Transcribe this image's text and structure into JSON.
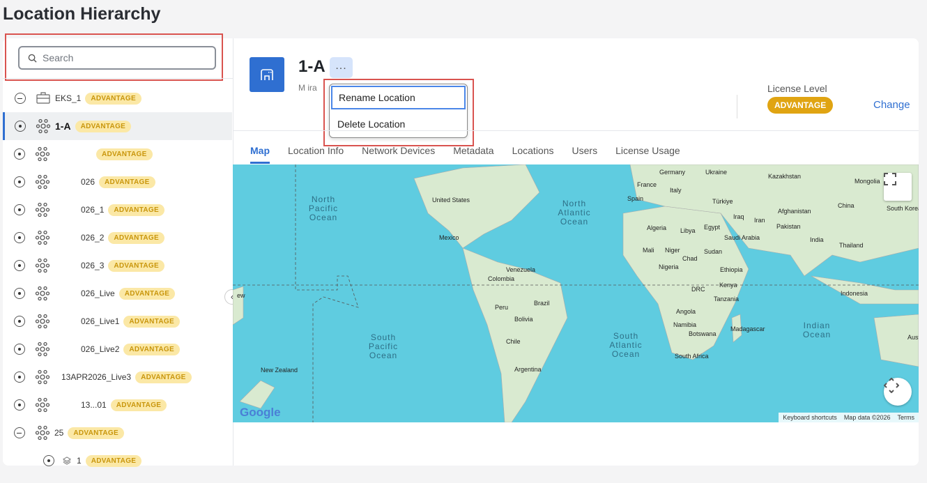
{
  "page_title": "Location Hierarchy",
  "search": {
    "placeholder": "Search"
  },
  "tree": [
    {
      "name": "EKS_1",
      "badge": "ADVANTAGE",
      "icon": "briefcase-icon",
      "toggle": "minus"
    },
    {
      "name": "1-A",
      "badge": "ADVANTAGE",
      "icon": "network-icon",
      "toggle": "dot",
      "selected": true
    },
    {
      "name": "",
      "badge": "ADVANTAGE",
      "icon": "network-icon",
      "toggle": "dot"
    },
    {
      "name": "026",
      "badge": "ADVANTAGE",
      "icon": "network-icon",
      "toggle": "dot"
    },
    {
      "name": "026_1",
      "badge": "ADVANTAGE",
      "icon": "network-icon",
      "toggle": "dot"
    },
    {
      "name": "026_2",
      "badge": "ADVANTAGE",
      "icon": "network-icon",
      "toggle": "dot"
    },
    {
      "name": "026_3",
      "badge": "ADVANTAGE",
      "icon": "network-icon",
      "toggle": "dot"
    },
    {
      "name": "026_Live",
      "badge": "ADVANTAGE",
      "icon": "network-icon",
      "toggle": "dot"
    },
    {
      "name": "026_Live1",
      "badge": "ADVANTAGE",
      "icon": "network-icon",
      "toggle": "dot"
    },
    {
      "name": "026_Live2",
      "badge": "ADVANTAGE",
      "icon": "network-icon",
      "toggle": "dot"
    },
    {
      "name": "13APR2026_Live3",
      "badge": "ADVANTAGE",
      "icon": "network-icon",
      "toggle": "dot"
    },
    {
      "name": "13...01",
      "badge": "ADVANTAGE",
      "icon": "network-icon",
      "toggle": "dot"
    },
    {
      "name": "25",
      "badge": "ADVANTAGE",
      "icon": "network-icon",
      "toggle": "minus"
    },
    {
      "name": "1",
      "badge": "ADVANTAGE",
      "icon": "layers-icon",
      "toggle": "dot",
      "indent": true
    }
  ],
  "detail": {
    "name": "1-A",
    "more": "...",
    "subtitle": "M  ira",
    "menu": [
      "Rename Location",
      "Delete Location"
    ],
    "license_label": "License Level",
    "license_value": "ADVANTAGE",
    "change": "Change",
    "tabs": [
      "Map",
      "Location Info",
      "Network Devices",
      "Metadata",
      "Locations",
      "Users",
      "License Usage"
    ]
  },
  "map": {
    "oceans": [
      "North Pacific Ocean",
      "North Atlantic Ocean",
      "South Pacific Ocean",
      "South Atlantic Ocean",
      "Indian Ocean"
    ],
    "labels": [
      "Germany",
      "Ukraine",
      "Kazakhstan",
      "Mongolia",
      "France",
      "Italy",
      "Türkiye",
      "China",
      "South Korea",
      "United States",
      "Spain",
      "Algeria",
      "Libya",
      "Egypt",
      "Iraq",
      "Iran",
      "Afghanistan",
      "Pakistan",
      "Mexico",
      "Saudi Arabia",
      "India",
      "Thailand",
      "Mali",
      "Niger",
      "Sudan",
      "Chad",
      "Nigeria",
      "Ethiopia",
      "Venezuela",
      "Colombia",
      "DRC",
      "Kenya",
      "Indonesia",
      "Peru",
      "Brazil",
      "Tanzania",
      "Bolivia",
      "Angola",
      "Namibia",
      "Madagascar",
      "Botswana",
      "Chile",
      "South Africa",
      "New Zealand",
      "Argentina",
      "Aust",
      "ew"
    ],
    "google": "Google",
    "attribution": [
      "Keyboard shortcuts",
      "Map data ©2026",
      "Terms"
    ]
  }
}
